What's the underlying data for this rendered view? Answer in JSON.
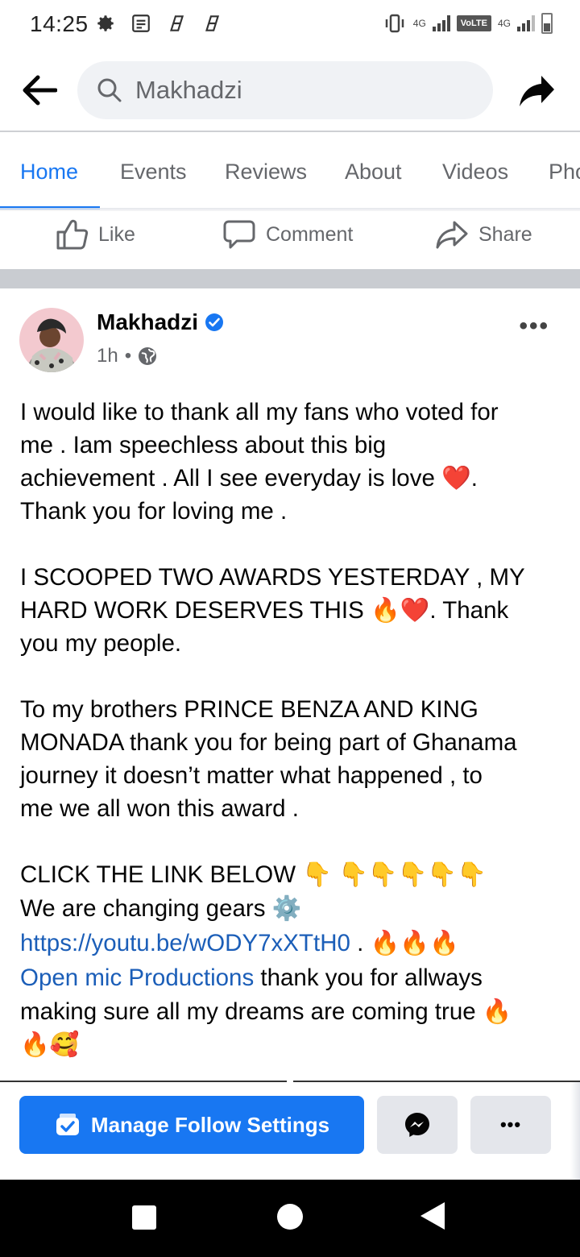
{
  "status_bar": {
    "time": "14:25",
    "network_1": "4G",
    "volte": "VoLTE",
    "network_2": "4G"
  },
  "search": {
    "query": "Makhadzi"
  },
  "tabs": [
    {
      "label": "Home",
      "active": true
    },
    {
      "label": "Events"
    },
    {
      "label": "Reviews"
    },
    {
      "label": "About"
    },
    {
      "label": "Videos"
    },
    {
      "label": "Pho"
    }
  ],
  "actions": {
    "like": "Like",
    "comment": "Comment",
    "share": "Share"
  },
  "post": {
    "author": "Makhadzi",
    "verified": true,
    "time": "1h",
    "privacy_icon": "globe-icon",
    "more": "•••",
    "para1": [
      "I would like to thank all my fans who voted for",
      "me . Iam speechless about this big",
      "achievement . All I see everyday is love ❤️.",
      "Thank you for loving me ."
    ],
    "para2": [
      "I SCOOPED TWO AWARDS YESTERDAY ,  MY",
      "HARD WORK DESERVES THIS 🔥❤️. Thank",
      "you my people."
    ],
    "para3": [
      "To my brothers PRINCE BENZA AND KING",
      "MONADA  thank you for being part of Ghanama",
      "journey  it doesn’t matter what happened  , to",
      "me we all won this award ."
    ],
    "para4_line1": "CLICK THE LINK BELOW 👇 👇👇👇👇👇",
    "para4_line2": "We are changing gears ⚙️",
    "link_url": "https://youtu.be/wODY7xXTtH0",
    "link_after": " . 🔥🔥🔥",
    "page_link": "Open mic Productions",
    "page_link_after": " thank you for allways",
    "last_line1": "making sure all my dreams are coming true 🔥",
    "last_line2": "🔥🥰"
  },
  "bottom_bar": {
    "manage_label": "Manage Follow Settings",
    "more": "•••"
  },
  "colors": {
    "accent": "#1877f2",
    "link": "#1b5eb8",
    "secondary_text": "#65676b",
    "button_gray": "#e4e6eb"
  }
}
